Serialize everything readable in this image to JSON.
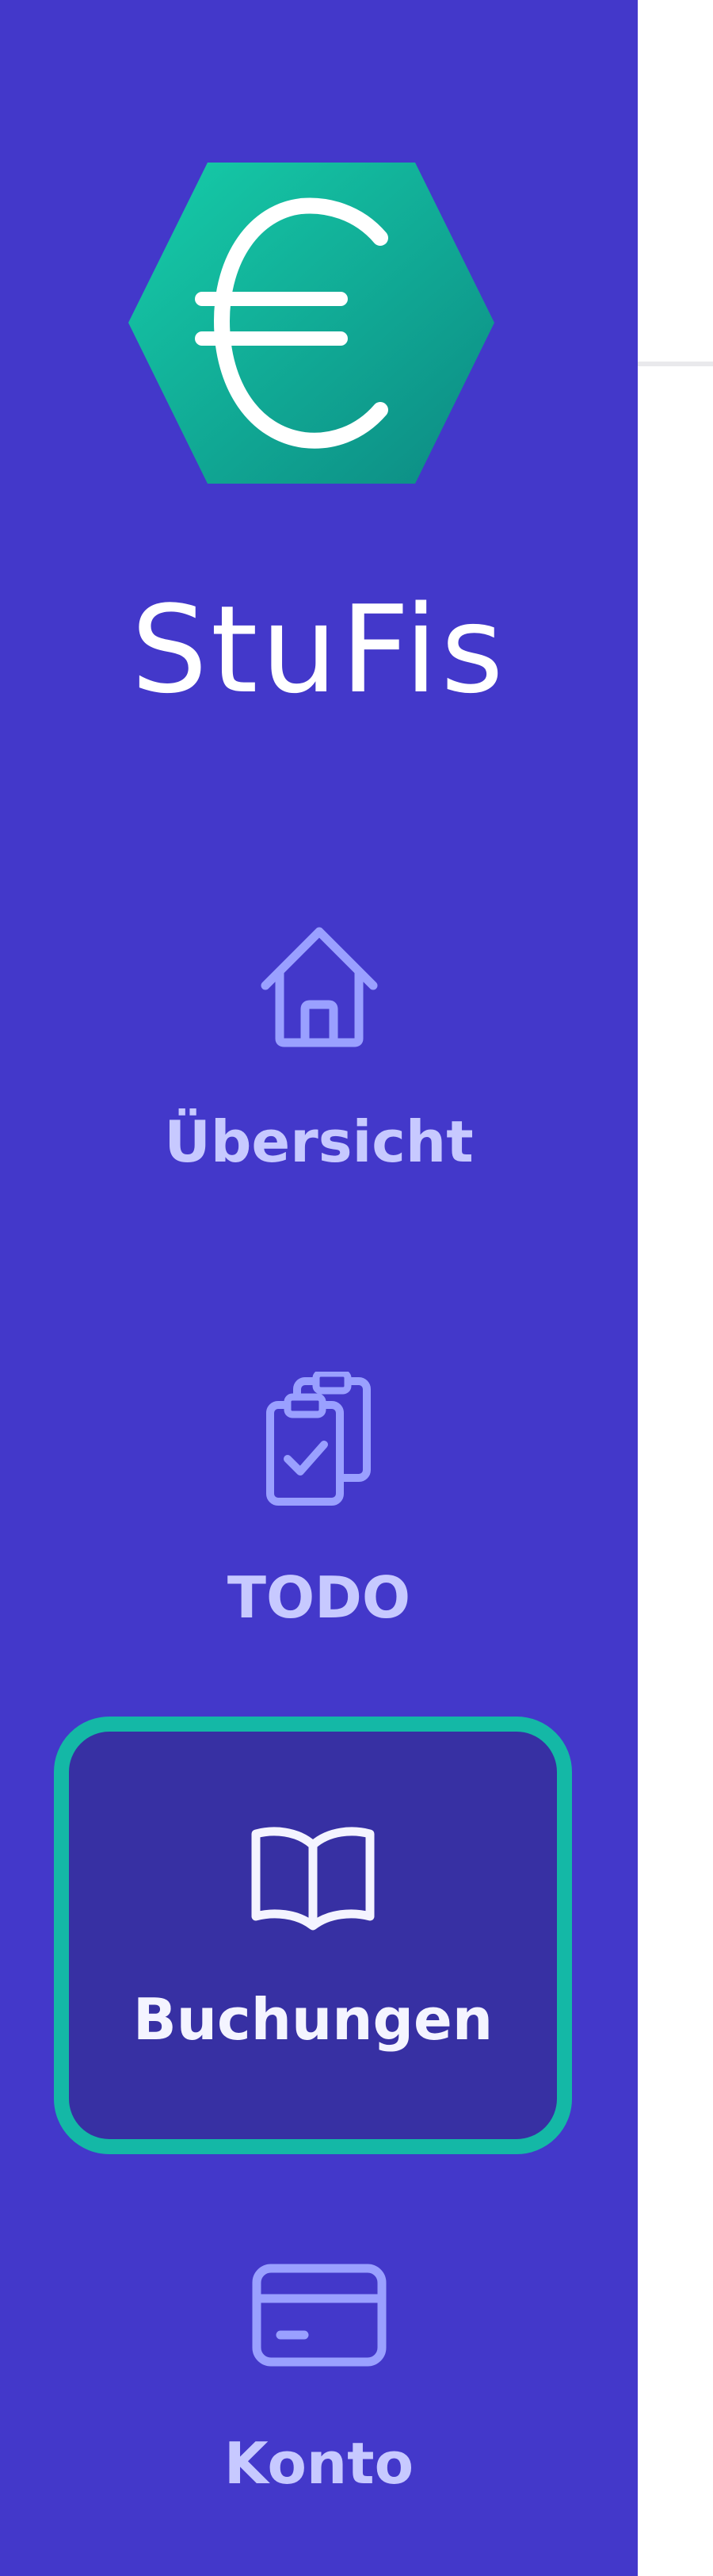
{
  "app": {
    "name": "StuFis",
    "logo_icon": "euro-hexagon-icon",
    "colors": {
      "sidebar": "#4338ca",
      "active_item": "#3730a3",
      "accent": "#14b8a6",
      "nav_text": "#c7c9ff",
      "logo_gradient_start": "#14c8a8",
      "logo_gradient_end": "#0d8f85"
    }
  },
  "sidebar": {
    "items": [
      {
        "label": "Übersicht",
        "icon": "home-icon",
        "active": false
      },
      {
        "label": "TODO",
        "icon": "clipboard-check-icon",
        "active": false
      },
      {
        "label": "Buchungen",
        "icon": "open-book-icon",
        "active": true
      },
      {
        "label": "Konto",
        "icon": "credit-card-icon",
        "active": false
      }
    ]
  }
}
